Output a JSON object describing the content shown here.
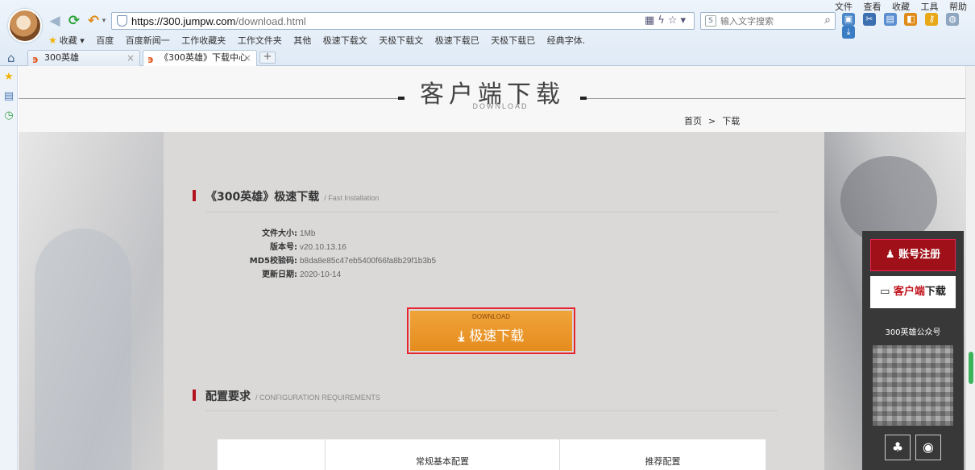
{
  "browser": {
    "url_host": "https://300.jumpw.com",
    "url_path": "/download.html",
    "search_placeholder": "输入文字搜索",
    "top_menu": [
      "文件",
      "查看",
      "收藏",
      "工具",
      "帮助"
    ],
    "bookmarks_label": "收藏",
    "bookmarks": [
      "百度",
      "百度新闻一",
      "工作收藏夹",
      "工作文件夹",
      "其他",
      "极速下载文",
      "天极下载文",
      "极速下载已",
      "天极下载已",
      "经典字体."
    ],
    "tabs": [
      {
        "label": "300英雄",
        "active": false
      },
      {
        "label": "《300英雄》下载中心",
        "active": true
      }
    ]
  },
  "header": {
    "title": "客户端下载",
    "subtitle": "DOWNLOAD",
    "breadcrumb_home": "首页",
    "breadcrumb_sep": ">",
    "breadcrumb_current": "下载"
  },
  "fast_install": {
    "title": "《300英雄》极速下载",
    "subtitle": "/ Fast Installation",
    "info": [
      {
        "key": "文件大小:",
        "value": "1Mb"
      },
      {
        "key": "版本号:",
        "value": "v20.10.13.16"
      },
      {
        "key": "MD5校验码:",
        "value": "b8da8e85c47eb5400f66fa8b29f1b3b5"
      },
      {
        "key": "更新日期:",
        "value": "2020-10-14"
      }
    ],
    "button_small": "DOWNLOAD",
    "button_label": "极速下载"
  },
  "config": {
    "title": "配置要求",
    "subtitle": "/ CONFIGURATION REQUIREMENTS",
    "columns": [
      "",
      "常规基本配置",
      "推荐配置"
    ]
  },
  "float_panel": {
    "register": "账号注册",
    "client_red": "客户端",
    "client_black": "下载",
    "wechat_label": "300英雄公众号"
  },
  "colors": {
    "accent_red": "#b5121b",
    "download_orange": "#e58c1e"
  }
}
